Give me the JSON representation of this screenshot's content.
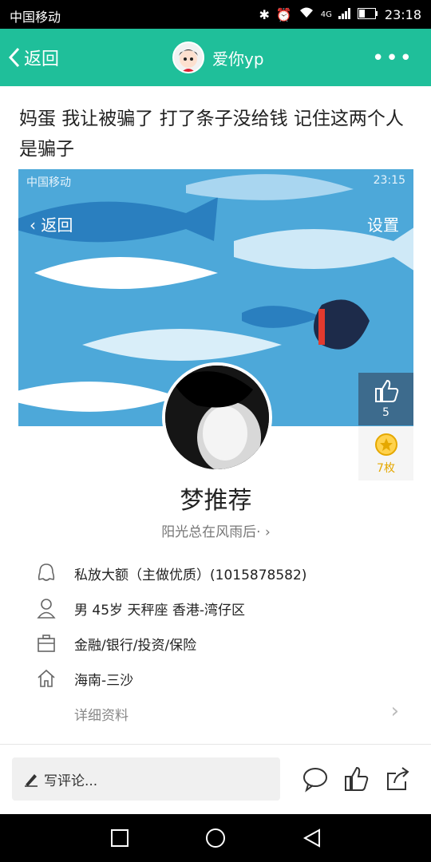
{
  "status_bar": {
    "carrier": "中国移动",
    "network": "4G",
    "time": "23:18"
  },
  "header": {
    "back_label": "返回",
    "username": "爱你yp",
    "more_label": "•••"
  },
  "post": {
    "text": "妈蛋  我让被骗了  打了条子没给钱  记住这两个人是骗子"
  },
  "screenshot": {
    "status_carrier": "中国移动",
    "status_time": "23:15",
    "back_label": "返回",
    "settings_label": "设置",
    "like_count": "5",
    "coin_label": "7枚",
    "profile_name": "梦推荐",
    "signature": "阳光总在风雨后·",
    "info": [
      {
        "icon": "qq-icon",
        "text": "私放大额（主做优质）(1015878582)"
      },
      {
        "icon": "person-icon",
        "text": "男  45岁  天秤座  香港-湾仔区"
      },
      {
        "icon": "briefcase-icon",
        "text": "金融/银行/投资/保险"
      },
      {
        "icon": "home-icon",
        "text": "海南-三沙"
      }
    ],
    "detail_label": "详细资料"
  },
  "bottom_bar": {
    "comment_placeholder": "写评论..."
  },
  "colors": {
    "accent": "#1fbf9a",
    "banner": "#4da8d9"
  }
}
